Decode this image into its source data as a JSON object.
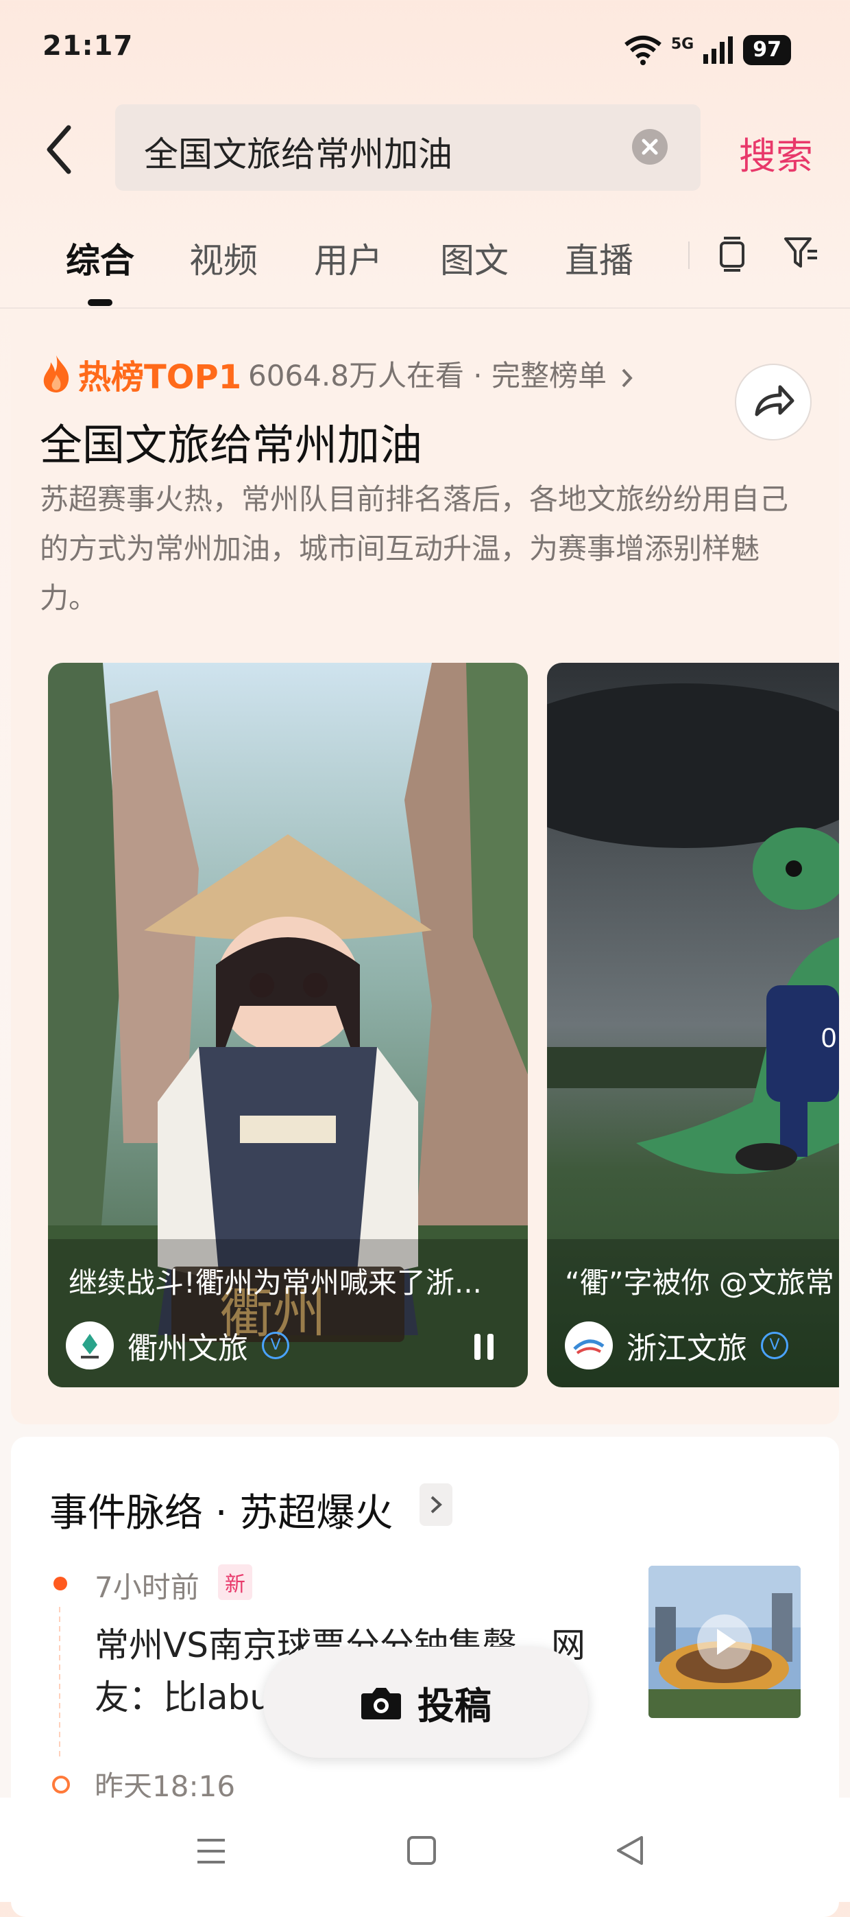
{
  "status": {
    "time": "21:17",
    "network": "5G",
    "battery": "97"
  },
  "search": {
    "query": "全国文旅给常州加油",
    "action_label": "搜索"
  },
  "tabs": [
    {
      "label": "综合",
      "active": true
    },
    {
      "label": "视频"
    },
    {
      "label": "用户"
    },
    {
      "label": "图文"
    },
    {
      "label": "直播"
    }
  ],
  "hot": {
    "tag": "热榜TOP1",
    "watch_text": "6064.8万人在看 · 完整榜单",
    "title": "全国文旅给常州加油",
    "description": "苏超赛事火热，常州队目前排名落后，各地文旅纷纷用自己的方式为常州加油，城市间互动升温，为赛事增添别样魅力。",
    "videos": [
      {
        "caption": "继续战斗!衢州为常州喊来了浙...",
        "author": "衢州文旅",
        "overlay_text": "衢州"
      },
      {
        "caption": "“衢”字被你 @文旅常",
        "author": "浙江文旅"
      }
    ]
  },
  "timeline": {
    "title": "事件脉络 · 苏超爆火",
    "events": [
      {
        "time": "7小时前",
        "badge": "新",
        "text": "常州VS南京球票分分钟售罄，网友：比labu"
      },
      {
        "time": "昨天18:16"
      }
    ]
  },
  "post_button": {
    "label": "投稿"
  },
  "colors": {
    "accent": "#e8386a",
    "hot": "#ff6a1a",
    "verified": "#4aa3ff"
  }
}
